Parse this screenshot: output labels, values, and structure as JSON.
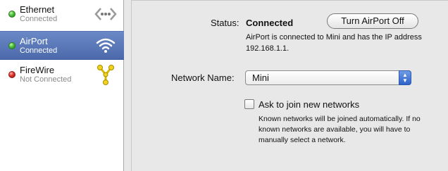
{
  "sidebar": {
    "services": [
      {
        "name": "Ethernet",
        "status": "Connected",
        "status_color": "green",
        "icon": "ethernet-icon",
        "selected": false
      },
      {
        "name": "AirPort",
        "status": "Connected",
        "status_color": "green",
        "icon": "airport-wifi-icon",
        "selected": true
      },
      {
        "name": "FireWire",
        "status": "Not Connected",
        "status_color": "red",
        "icon": "firewire-icon",
        "selected": false
      }
    ]
  },
  "main": {
    "status_label": "Status:",
    "status_value": "Connected",
    "turn_off_button": "Turn AirPort Off",
    "status_description": "AirPort is connected to Mini and has the IP address 192.168.1.1.",
    "network_name_label": "Network Name:",
    "network_name_value": "Mini",
    "ask_to_join_label": "Ask to join new networks",
    "ask_to_join_checked": false,
    "ask_to_join_help": "Known networks will be joined automatically. If no known networks are available, you will have to manually select a network."
  },
  "colors": {
    "selection": "#5878b8",
    "status_green": "#3fb02f",
    "status_red": "#d8281f"
  }
}
